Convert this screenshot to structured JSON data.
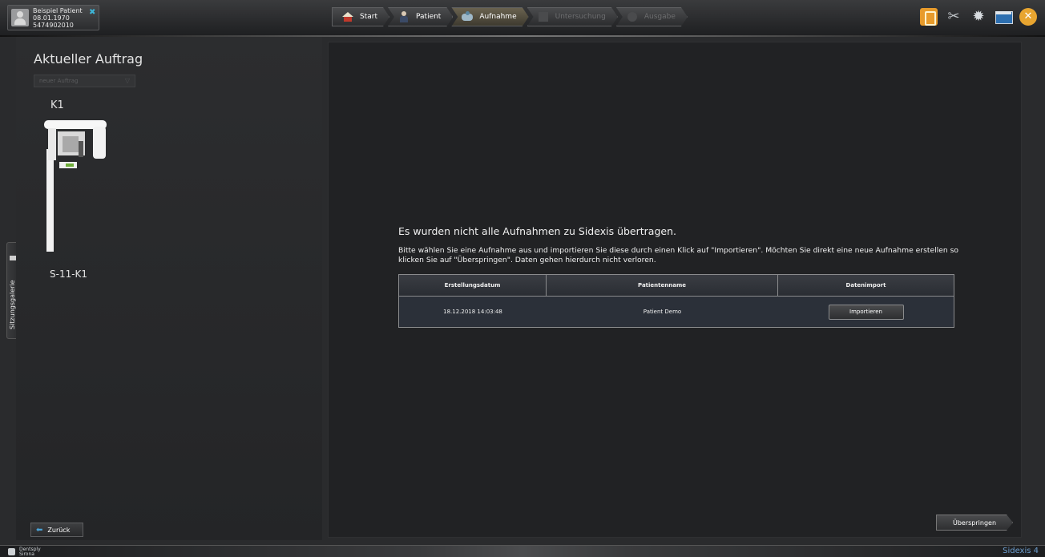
{
  "patient": {
    "name": "Beispiel Patient",
    "birth_date": "08.01.1970",
    "id": "5474902010"
  },
  "workflow": {
    "steps": [
      {
        "label": "Start",
        "icon": "home-icon"
      },
      {
        "label": "Patient",
        "icon": "person-icon"
      },
      {
        "label": "Aufnahme",
        "icon": "capture-icon",
        "active": true
      },
      {
        "label": "Untersuchung",
        "icon": "examination-icon",
        "disabled": true
      },
      {
        "label": "Ausgabe",
        "icon": "output-icon",
        "disabled": true
      }
    ]
  },
  "toolbar": {
    "icons": [
      "info-book-icon",
      "tools-icon",
      "settings-gear-icon",
      "window-icon",
      "close-icon"
    ]
  },
  "left_panel": {
    "title": "Aktueller Auftrag",
    "order_select": "neuer Auftrag",
    "device_label": "K1",
    "device_id": "S-11-K1",
    "side_tab": "Sitzungsgalerie",
    "back_button": "Zurück"
  },
  "main": {
    "title": "Es wurden nicht alle Aufnahmen zu Sidexis übertragen.",
    "description": "Bitte wählen Sie eine Aufnahme aus und importieren Sie diese durch einen Klick auf \"Importieren\". Möchten Sie direkt eine neue Aufnahme erstellen so klicken Sie auf \"Überspringen\". Daten gehen hierdurch nicht verloren.",
    "table": {
      "headers": [
        "Erstellungsdatum",
        "Patientenname",
        "Datenimport"
      ],
      "rows": [
        {
          "date": "18.12.2018 14:03:48",
          "patient": "Patient Demo",
          "action": "Importieren"
        }
      ]
    },
    "skip_button": "Überspringen"
  },
  "footer": {
    "brand": "Dentsply Sirona",
    "brand_line1": "Dentsply",
    "brand_line2": "Sirona",
    "app_name": "Sidexis 4"
  },
  "colors": {
    "background": "#2a2b2d",
    "accent_blue": "#4aa3d8",
    "close_orange": "#e8a530",
    "table_bg": "#2b3039"
  }
}
